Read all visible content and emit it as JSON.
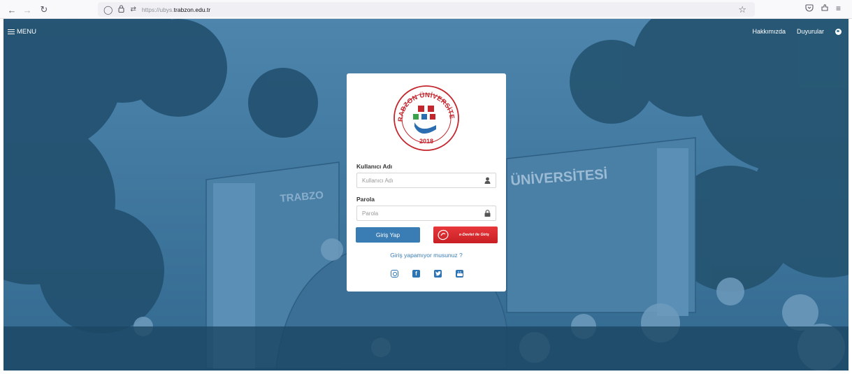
{
  "browser": {
    "url_prefix": "https://ubys.",
    "url_domain": "trabzon.edu.tr"
  },
  "header": {
    "menu_label": "MENU",
    "links": [
      "Hakkımızda",
      "Duyurular"
    ]
  },
  "login": {
    "username_label": "Kullanıcı Adı",
    "username_placeholder": "Kullanıcı Adı",
    "password_label": "Parola",
    "password_placeholder": "Parola",
    "login_button": "Giriş Yap",
    "edevlet_button": "e-Devlet ile Giriş",
    "help_link": "Giriş yapamıyor musunuz ?"
  },
  "logo": {
    "top_text": "TRABZON ÜNİVERSİTESİ",
    "year": "2018"
  },
  "social": [
    "instagram-icon",
    "facebook-icon",
    "twitter-icon",
    "youtube-icon"
  ],
  "colors": {
    "overlay": "#3e7aa3",
    "primary_button": "#3a7cb4",
    "edevlet_button": "#d52a2e",
    "logo_red": "#c4262e",
    "logo_blue": "#2a6db0",
    "logo_green": "#3aa24a"
  }
}
